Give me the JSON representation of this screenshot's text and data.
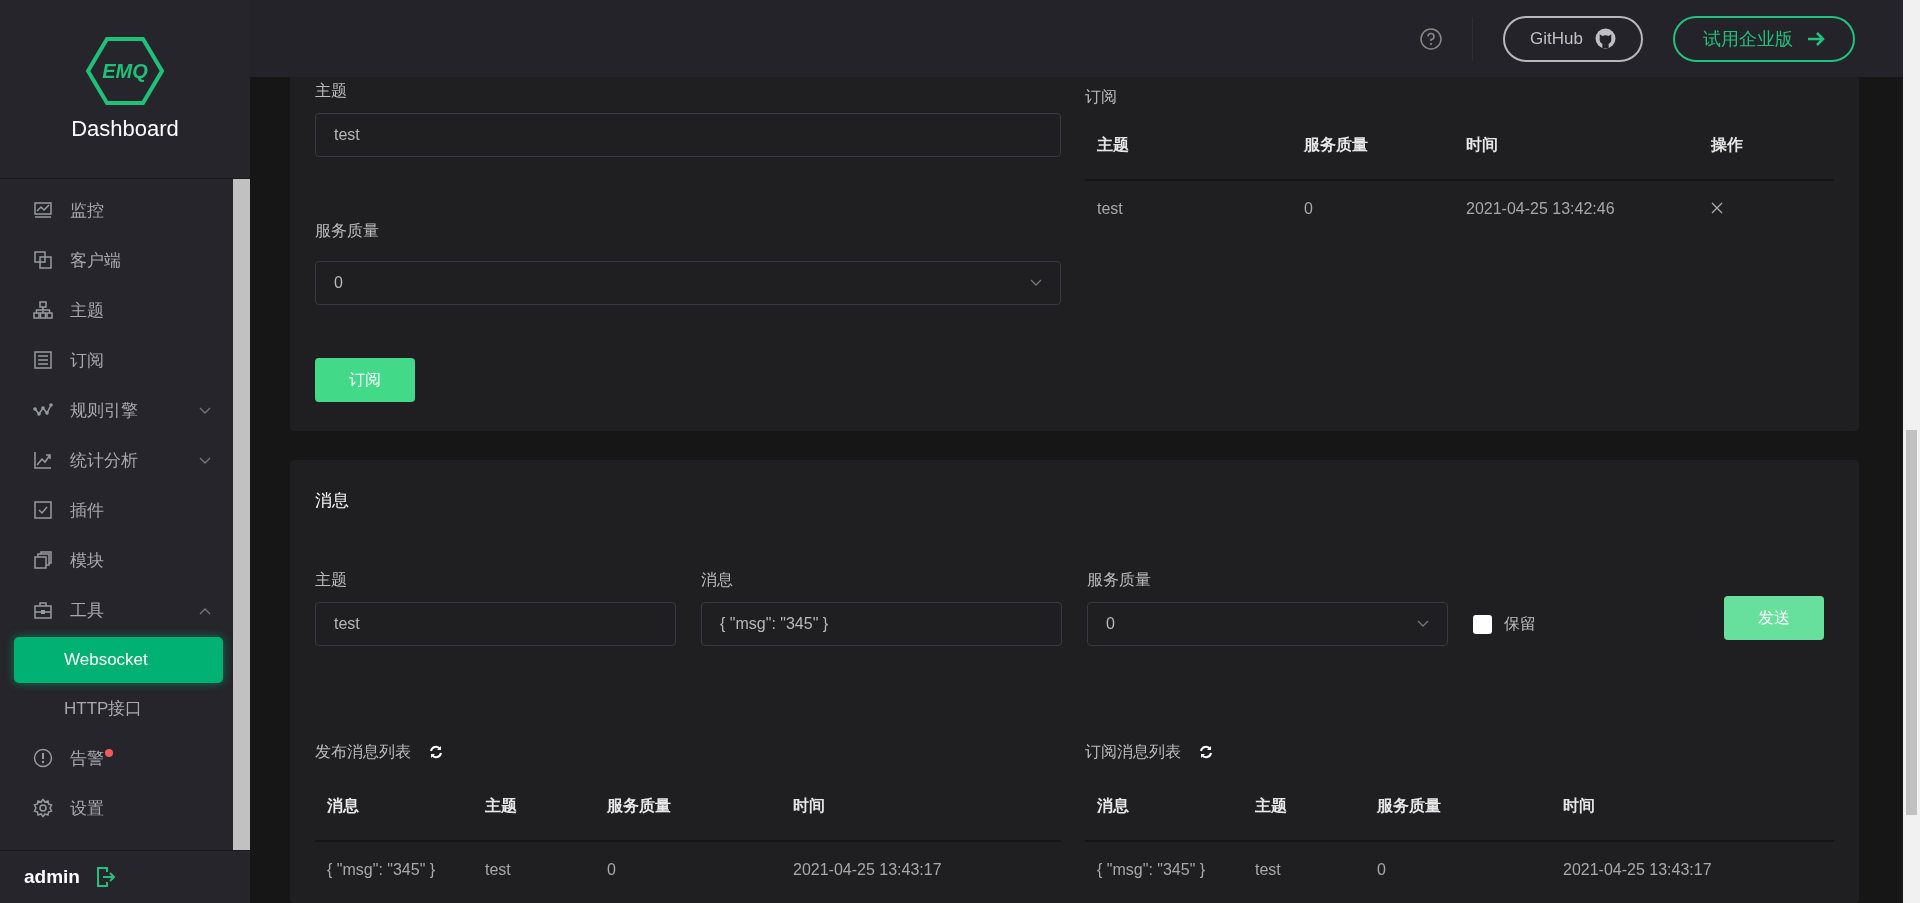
{
  "sidebar": {
    "logo": "EMQ",
    "title": "Dashboard",
    "items": [
      {
        "label": "监控",
        "dot": false
      },
      {
        "label": "客户端",
        "dot": false
      },
      {
        "label": "主题",
        "dot": false
      },
      {
        "label": "订阅",
        "dot": false
      },
      {
        "label": "规则引擎",
        "dot": false,
        "expanded": false
      },
      {
        "label": "统计分析",
        "dot": false,
        "expanded": false
      },
      {
        "label": "插件",
        "dot": false
      },
      {
        "label": "模块",
        "dot": false
      },
      {
        "label": "工具",
        "dot": false,
        "expanded": true,
        "children": [
          {
            "label": "Websocket",
            "selected": true
          },
          {
            "label": "HTTP接口",
            "selected": false
          }
        ]
      },
      {
        "label": "告警",
        "dot": true
      },
      {
        "label": "设置",
        "dot": false
      }
    ],
    "user": "admin"
  },
  "header": {
    "github": "GitHub",
    "enterprise": "试用企业版"
  },
  "subscribe": {
    "topic_label": "主题",
    "topic_value": "test",
    "qos_label": "服务质量",
    "qos_value": "0",
    "button": "订阅"
  },
  "subscriptions": {
    "title": "订阅",
    "columns": [
      "主题",
      "服务质量",
      "时间",
      "操作"
    ],
    "rows": [
      [
        "test",
        "0",
        "2021-04-25 13:42:46"
      ]
    ]
  },
  "messages": {
    "title": "消息",
    "topic_label": "主题",
    "topic_value": "test",
    "message_label": "消息",
    "message_value": "{ \"msg\": \"345\" }",
    "qos_label": "服务质量",
    "qos_value": "0",
    "retain": {
      "label": "保留",
      "checked": false
    },
    "button": "发送"
  },
  "published": {
    "title": "发布消息列表",
    "columns": [
      "消息",
      "主题",
      "服务质量",
      "时间"
    ],
    "rows": [
      [
        "{ \"msg\": \"345\" }",
        "test",
        "0",
        "2021-04-25 13:43:17"
      ]
    ]
  },
  "received": {
    "title": "订阅消息列表",
    "columns": [
      "消息",
      "主题",
      "服务质量",
      "时间"
    ],
    "rows": [
      [
        "{ \"msg\": \"345\" }",
        "test",
        "0",
        "2021-04-25 13:43:17"
      ]
    ]
  }
}
